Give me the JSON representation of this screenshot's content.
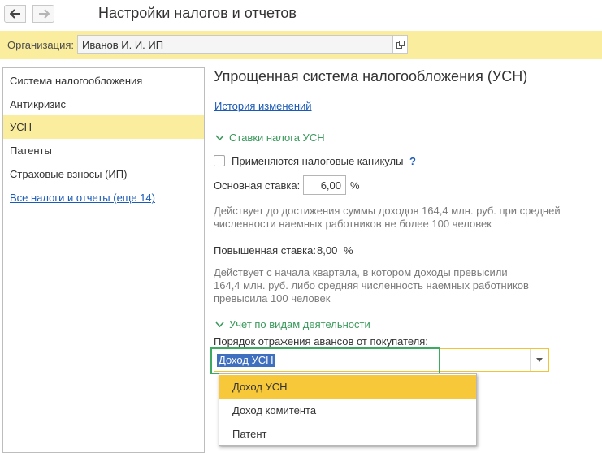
{
  "window": {
    "title": "Настройки налогов и отчетов",
    "back_icon": "arrow-left-icon",
    "forward_icon": "arrow-right-icon"
  },
  "org": {
    "label": "Организация:",
    "value": "Иванов И. И. ИП",
    "open_icon": "open-form-icon"
  },
  "sidebar": {
    "items": [
      {
        "label": "Система налогообложения"
      },
      {
        "label": "Антикризис"
      },
      {
        "label": "УСН",
        "selected": true
      },
      {
        "label": "Патенты"
      },
      {
        "label": "Страховые взносы (ИП)"
      }
    ],
    "more_link": "Все налоги и отчеты (еще 14)"
  },
  "main": {
    "title": "Упрощенная система налогообложения (УСН)",
    "history_link": "История изменений",
    "section_rates": {
      "title": "Ставки налога УСН",
      "holidays_checkbox": {
        "label": "Применяются налоговые каникулы",
        "checked": false,
        "help": "?"
      },
      "base_rate": {
        "label": "Основная ставка:",
        "value": "6,00",
        "unit": "%"
      },
      "base_note_1": "Действует до достижения суммы доходов 164,4 млн. руб. при средней",
      "base_note_2": "численности наемных работников не более 100 человек",
      "high_rate": {
        "label": "Повышенная ставка:",
        "value": "8,00",
        "unit": "%"
      },
      "high_note_1": "Действует с начала квартала, в котором доходы превысили",
      "high_note_2": "164,4 млн. руб. либо средняя численность наемных работников",
      "high_note_3": "превысила 100 человек"
    },
    "section_activity": {
      "title": "Учет по видам деятельности",
      "advance_label": "Порядок отражения авансов от покупателя:",
      "advance_value": "Доход УСН",
      "options": [
        "Доход УСН",
        "Доход комитента",
        "Патент"
      ]
    }
  },
  "colors": {
    "accent_yellow": "#fbed9e",
    "dropdown_highlight": "#f6c83a",
    "link_blue": "#1b5bb7",
    "group_green": "#3b9a5c",
    "focus_green": "#3daa61"
  }
}
